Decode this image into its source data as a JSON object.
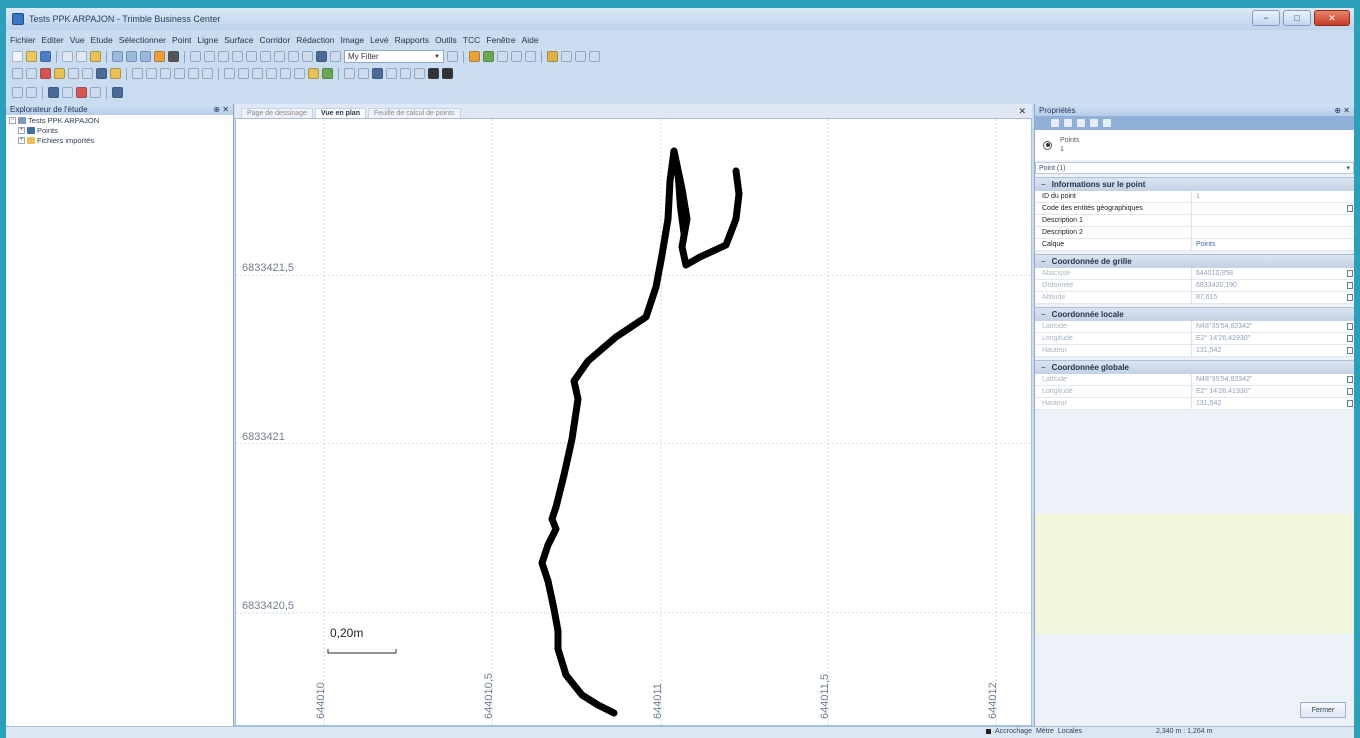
{
  "window": {
    "title": "Tests PPK ARPAJON - Trimble Business Center"
  },
  "menu": [
    "Fichier",
    "Editer",
    "Vue",
    "Etude",
    "Sélectionner",
    "Point",
    "Ligne",
    "Surface",
    "Corridor",
    "Rédaction",
    "Image",
    "Levé",
    "Rapports",
    "Outils",
    "TCC",
    "Fenêtre",
    "Aide"
  ],
  "toolbar": {
    "filter_value": "My Filter"
  },
  "explorer": {
    "title": "Explorateur de l'étude",
    "root": "Tests PPK ARPAJON",
    "children": [
      "Points",
      "Fichiers importés"
    ]
  },
  "document": {
    "tabs": [
      "Page de dessinage",
      "Vue en plan",
      "Feuille de calcul de points"
    ],
    "active_tab": 1
  },
  "plan": {
    "y_labels": [
      "6833421,5",
      "6833421",
      "6833420,5"
    ],
    "x_labels": [
      "644010",
      "644010,5",
      "644011",
      "644011,5",
      "644012"
    ],
    "scale_label": "0,20m"
  },
  "properties": {
    "title": "Propriétés",
    "object_name": "Points",
    "object_count": "1",
    "selector": "Point (1)",
    "sections": [
      {
        "title": "Informations sur le point",
        "rows": [
          {
            "label": "ID du point",
            "value": "1"
          },
          {
            "label": "Code des entités géographiques",
            "value": ""
          },
          {
            "label": "Description 1",
            "value": ""
          },
          {
            "label": "Description 2",
            "value": ""
          },
          {
            "label": "Calque",
            "value": "Points"
          }
        ]
      },
      {
        "title": "Coordonnée de grille",
        "rows": [
          {
            "label": "Abscisse",
            "value": "644010,858"
          },
          {
            "label": "Ordonnée",
            "value": "6833420,190"
          },
          {
            "label": "Altitude",
            "value": "87,615"
          }
        ]
      },
      {
        "title": "Coordonnée locale",
        "rows": [
          {
            "label": "Latitude",
            "value": "N48°35'54,82342\""
          },
          {
            "label": "Longitude",
            "value": "E2° 14'26,41930\""
          },
          {
            "label": "Hauteur",
            "value": "131,542"
          }
        ]
      },
      {
        "title": "Coordonnée globale",
        "rows": [
          {
            "label": "Latitude",
            "value": "N48°35'54,82342\""
          },
          {
            "label": "Longitude",
            "value": "E2° 14'26,41930\""
          },
          {
            "label": "Hauteur",
            "value": "131,542"
          }
        ]
      }
    ],
    "close_label": "Fermer"
  },
  "status": {
    "snap": "Accrochage",
    "units": "Mètre",
    "coord_system": "Locales",
    "scale": "2,340 m : 1,264 m"
  },
  "colors": {
    "accent": "#2ba0ba",
    "track": "#000000"
  }
}
